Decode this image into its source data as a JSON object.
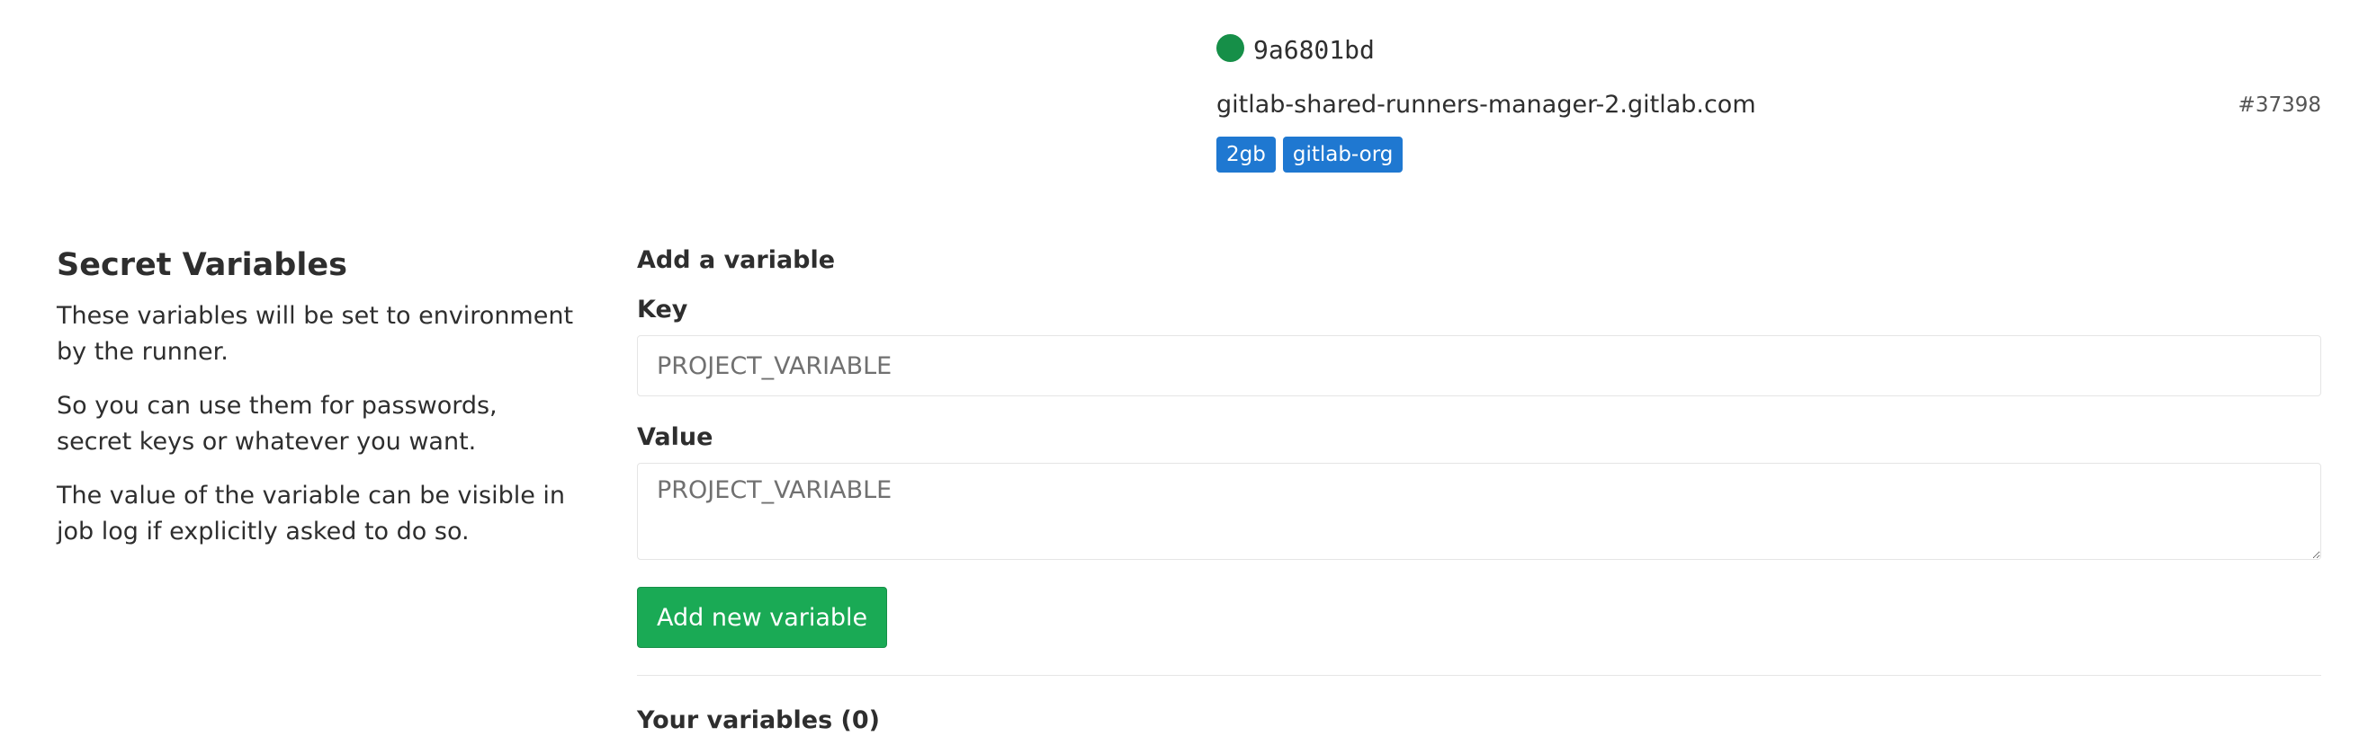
{
  "runner": {
    "status_color": "#168f48",
    "id": "9a6801bd",
    "description": "gitlab-shared-runners-manager-2.gitlab.com",
    "number": "#37398",
    "tags": [
      "2gb",
      "gitlab-org"
    ],
    "tag_color": "#1f78d1"
  },
  "section": {
    "title": "Secret Variables",
    "paragraphs": [
      "These variables will be set to environment by the runner.",
      "So you can use them for passwords, secret keys or whatever you want.",
      "The value of the variable can be visible in job log if explicitly asked to do so."
    ]
  },
  "form": {
    "title": "Add a variable",
    "key_label": "Key",
    "key_placeholder": "PROJECT_VARIABLE",
    "value_label": "Value",
    "value_placeholder": "PROJECT_VARIABLE",
    "submit_label": "Add new variable",
    "submit_color": "#1aaa55"
  },
  "variables": {
    "title": "Your variables (0)"
  }
}
